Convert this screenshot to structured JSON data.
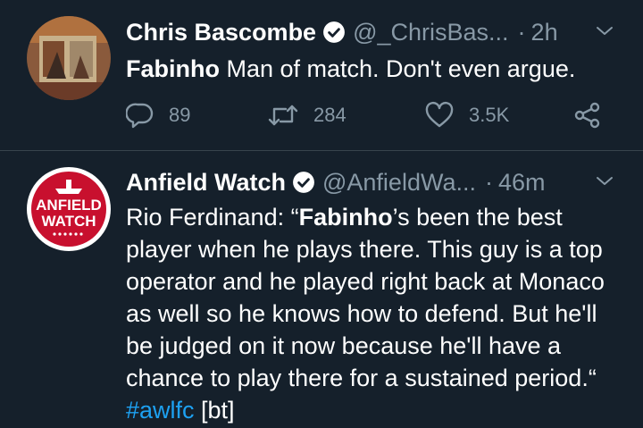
{
  "tweets": [
    {
      "name": "Chris Bascombe",
      "handle": "@_ChrisBas...",
      "dot": "·",
      "time": "2h",
      "text_bold": "Fabinho",
      "text_rest": " Man of match. Don't even argue.",
      "replies": "89",
      "retweets": "284",
      "likes": "3.5K"
    },
    {
      "name": "Anfield Watch",
      "handle": "@AnfieldWa...",
      "dot": "·",
      "time": "46m",
      "avatar_line1": "ANFIELD",
      "avatar_line2": "WATCH",
      "text_pre": "Rio Ferdinand: “",
      "text_bold": "Fabinho",
      "text_rest": "’s been the best player when he plays there. This guy is a top operator and he played right back at Monaco as well so he knows how to defend. But he'll be judged on it now because he'll have a chance to play there for a sustained period.“ ",
      "hashtag": "#awlfc",
      "suffix": " [bt]"
    }
  ],
  "colors": {
    "background": "#15202b",
    "secondary_text": "#8899a6",
    "link": "#1da1f2",
    "divider": "#38444d",
    "avatar_red": "#c8102e"
  }
}
